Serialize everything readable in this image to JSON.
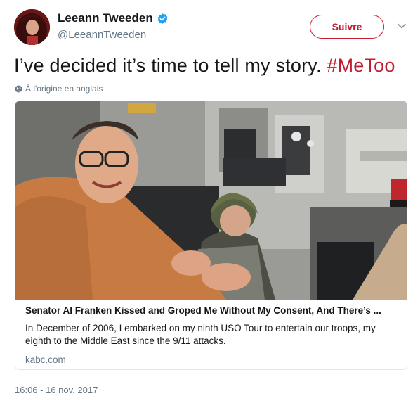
{
  "author": {
    "name": "Leeann Tweeden",
    "handle": "@LeeannTweeden",
    "verified": true,
    "verified_icon": "verified-badge-icon"
  },
  "follow_button": {
    "label": "Suivre"
  },
  "menu_icon": "chevron-down-icon",
  "tweet": {
    "text": "I’ve decided it’s time to tell my story. ",
    "hashtag": "#MeToo",
    "translation_note": "À l'origine en anglais"
  },
  "card": {
    "title": "Senator Al Franken Kissed and Groped Me Without My Consent, And There’s ...",
    "description": "In December of 2006, I embarked on my ninth USO Tour to entertain our troops, my eighth to the Middle East since the 9/11 attacks.",
    "domain": "kabc.com"
  },
  "timestamp": "16:06 - 16 nov. 2017",
  "colors": {
    "accent": "#c21d31",
    "verified": "#1da1f2",
    "muted": "#657786",
    "text": "#14171a",
    "border": "#e1e8ed"
  }
}
